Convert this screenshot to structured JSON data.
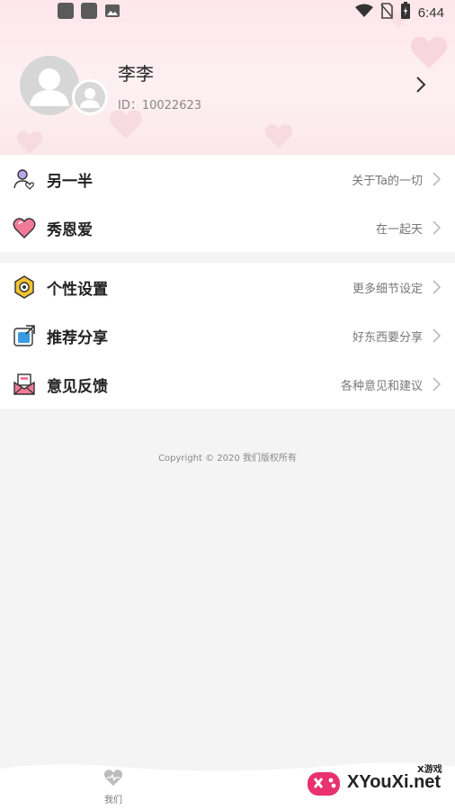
{
  "status_bar": {
    "time": "6:44",
    "left_icons": [
      "app-notification-icon",
      "app-notification-icon",
      "image-icon"
    ],
    "right_icons": [
      "wifi-icon",
      "no-sim-icon",
      "battery-icon"
    ]
  },
  "profile": {
    "name": "李李",
    "id_text": "ID：10022623"
  },
  "menu_group_1": [
    {
      "label": "另一半",
      "desc": "关于Ta的一切",
      "icon": "partner-icon"
    },
    {
      "label": "秀恩爱",
      "desc": "在一起天",
      "icon": "heart-icon"
    }
  ],
  "menu_group_2": [
    {
      "label": "个性设置",
      "desc": "更多细节设定",
      "icon": "settings-icon"
    },
    {
      "label": "推荐分享",
      "desc": "好东西要分享",
      "icon": "share-icon"
    },
    {
      "label": "意见反馈",
      "desc": "各种意见和建议",
      "icon": "feedback-mail-icon"
    }
  ],
  "copyright": "Copyright © 2020 我们版权所有",
  "bottom_nav": {
    "tab_label": "我们"
  },
  "watermark": {
    "text": "XYouXi.net",
    "small": "X游戏"
  },
  "colors": {
    "header_bg": "#fde6ec",
    "accent_pink": "#f07a98",
    "page_bg": "#f4f4f4"
  }
}
